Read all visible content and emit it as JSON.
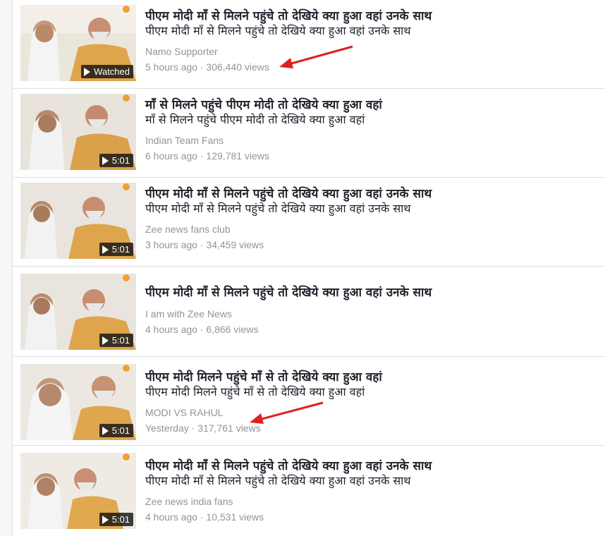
{
  "videos": [
    {
      "title": "पीएम मोदी माँ से मिलने पहुंचे तो देखिये क्या हुआ वहां उनके साथ",
      "subtitle": "पीएम मोदी माँ से मिलने पहुंचे तो देखिये क्या हुआ वहां उनके साथ",
      "channel": "Namo Supporter",
      "time": "5 hours ago",
      "sep": "·",
      "views": "306,440 views",
      "badge": "Watched"
    },
    {
      "title": "माँ से मिलने पहुंचे पीएम मोदी तो देखिये क्या हुआ वहां",
      "subtitle": "माँ से मिलने पहुंचे पीएम मोदी तो देखिये क्या हुआ वहां",
      "channel": "Indian Team Fans",
      "time": "6 hours ago",
      "sep": "·",
      "views": "129,781 views",
      "badge": "5:01"
    },
    {
      "title": "पीएम मोदी माँ से मिलने पहुंचे तो देखिये क्या हुआ वहां उनके साथ",
      "subtitle": "पीएम मोदी माँ से मिलने पहुंचे तो देखिये क्या हुआ वहां उनके साथ",
      "channel": "Zee news fans club",
      "time": "3 hours ago",
      "sep": "·",
      "views": "34,459 views",
      "badge": "5:01"
    },
    {
      "title": "पीएम मोदी माँ से मिलने पहुंचे तो देखिये क्या हुआ वहां उनके साथ",
      "subtitle": "",
      "channel": "I am with Zee News",
      "time": "4 hours ago",
      "sep": "·",
      "views": "6,866 views",
      "badge": "5:01"
    },
    {
      "title": "पीएम मोदी मिलने पहुंचे माँ से तो देखिये क्या हुआ वहां",
      "subtitle": "पीएम मोदी मिलने पहुंचे माँ से तो देखिये क्या हुआ वहां",
      "channel": "MODI VS RAHUL",
      "time": "Yesterday",
      "sep": "·",
      "views": "317,761 views",
      "badge": "5:01"
    },
    {
      "title": "पीएम मोदी माँ से मिलने पहुंचे तो देखिये क्या हुआ वहां उनके साथ",
      "subtitle": "पीएम मोदी माँ से मिलने पहुंचे तो देखिये क्या हुआ वहां उनके साथ",
      "channel": "Zee news india fans",
      "time": "4 hours ago",
      "sep": "·",
      "views": "10,531 views",
      "badge": "5:01"
    }
  ],
  "colors": {
    "title": "#1d2129",
    "meta": "#90949c",
    "divider": "#dddfe2",
    "annotation_arrow": "#e02020"
  }
}
